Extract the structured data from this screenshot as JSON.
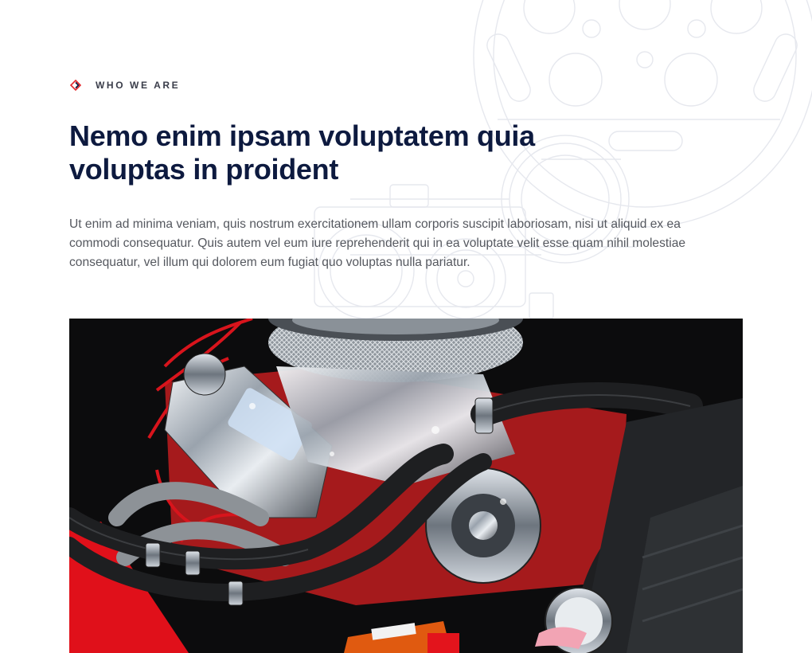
{
  "section": {
    "eyebrow": "WHO WE ARE",
    "heading": "Nemo enim ipsam voluptatem quia voluptas in proident",
    "body": "Ut enim ad minima veniam, quis nostrum exercitationem ullam corporis suscipit laboriosam, nisi ut aliquid ex ea commodi consequatur. Quis autem vel eum iure reprehenderit qui in ea voluptate velit esse quam nihil molestiae consequatur, vel illum qui dolorem eum fugiat quo voluptas nulla pariatur."
  },
  "icons": {
    "eyebrow": "diamond-outline-icon"
  },
  "images": {
    "main": "car engine bay photo"
  },
  "colors": {
    "heading": "#0d1a3f",
    "accent_red": "#e3262b",
    "body_text": "#55585f",
    "eyebrow_text": "#3a3d4a"
  }
}
